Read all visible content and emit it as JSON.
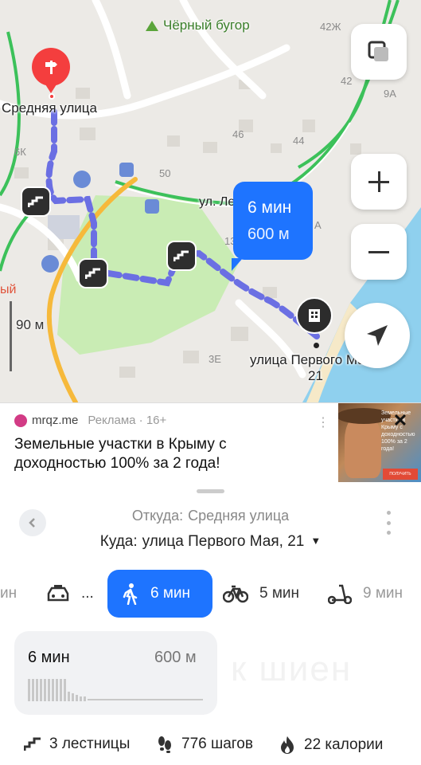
{
  "map": {
    "hill_label": "Чёрный бугор",
    "start_label": "Средняя улица",
    "dest_label_line1": "улица Первого Мая,",
    "dest_label_line2": "21",
    "street_label": "ул. Ле",
    "scale_label": "90 м",
    "house_numbers": [
      "42Ж",
      "42",
      "9А",
      "46",
      "44",
      "6К",
      "50",
      "13",
      "А",
      "3Е",
      "ый"
    ],
    "route_bubble": {
      "time": "6 мин",
      "distance": "600 м"
    }
  },
  "ad": {
    "site": "mrqz.me",
    "meta": "Реклама · 16+",
    "text": "Земельные участки в Крыму с доходностью 100% за 2 года!",
    "image_text": "Земельные участки в Крыму с доходностью 100% за 2 года!",
    "image_cta": "ПОЛУЧИТЬ ПОДБОРКУ"
  },
  "panel": {
    "from_label": "Откуда:",
    "from_value": "Средняя улица",
    "to_label": "Куда:",
    "to_value": "улица Первого Мая, 21",
    "modes": [
      {
        "name": "partial",
        "label": "ин"
      },
      {
        "name": "taxi",
        "label": "..."
      },
      {
        "name": "walk",
        "label": "6 мин"
      },
      {
        "name": "bike",
        "label": "5 мин"
      },
      {
        "name": "scooter",
        "label": "9 мин"
      }
    ],
    "route_card": {
      "time": "6 мин",
      "distance": "600 м"
    },
    "watermark": "к шиен",
    "stats": {
      "stairs": "3 лестницы",
      "steps": "776 шагов",
      "calories": "22 калории"
    }
  },
  "colors": {
    "accent": "#1e74ff",
    "route": "#6b6fe3",
    "pin": "#f43e3e",
    "park": "#c9ecb4",
    "water": "#8fd0ee",
    "road_green": "#3cc15a",
    "road_yellow": "#f6b93b"
  }
}
